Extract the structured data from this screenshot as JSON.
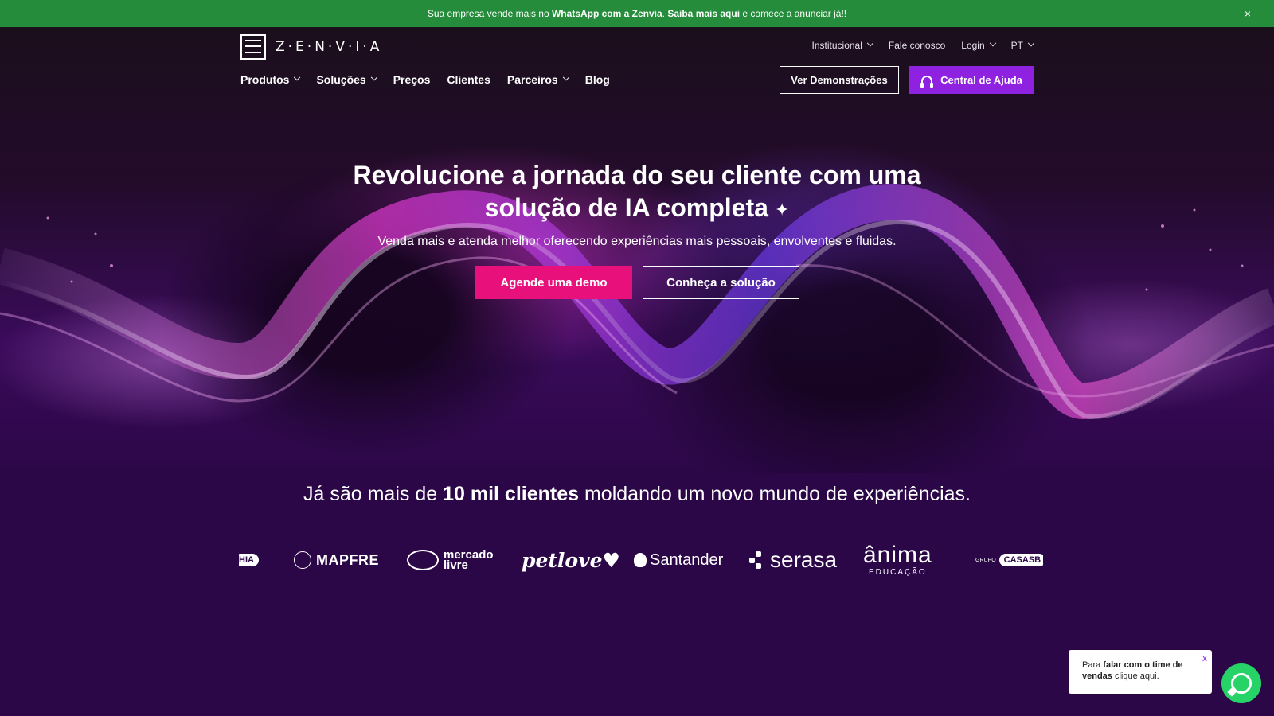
{
  "announcement": {
    "prefix": "Sua empresa vende mais no ",
    "bold": "WhatsApp com a Zenvia",
    "dot": ". ",
    "link": "Saiba mais aqui",
    "suffix": " e comece a anunciar já!!",
    "close": "×"
  },
  "header": {
    "logo_text": "Z·E·N·V·I·A",
    "topnav": [
      {
        "label": "Institucional",
        "dropdown": true
      },
      {
        "label": "Fale conosco",
        "dropdown": false
      },
      {
        "label": "Login",
        "dropdown": true
      },
      {
        "label": "PT",
        "dropdown": true
      }
    ],
    "mainnav": [
      {
        "label": "Produtos",
        "dropdown": true
      },
      {
        "label": "Soluções",
        "dropdown": true
      },
      {
        "label": "Preços",
        "dropdown": false
      },
      {
        "label": "Clientes",
        "dropdown": false
      },
      {
        "label": "Parceiros",
        "dropdown": true
      },
      {
        "label": "Blog",
        "dropdown": false
      }
    ],
    "btn_demos": "Ver Demonstrações",
    "btn_help": "Central de Ajuda"
  },
  "hero": {
    "title_line1": "Revolucione a jornada do seu cliente com uma",
    "title_line2": "solução de IA completa",
    "subtitle": "Venda mais e atenda melhor oferecendo experiências mais pessoais, envolventes e fluidas.",
    "btn_primary": "Agende uma demo",
    "btn_secondary": "Conheça a solução"
  },
  "clients": {
    "title_prefix": "Já são mais de ",
    "title_bold": "10 mil clientes",
    "title_suffix": " moldando um novo mundo de experiências.",
    "logos": {
      "edge_left": "HIA",
      "mapfre": "MAPFRE",
      "mercado_1": "mercado",
      "mercado_2": "livre",
      "petlove": "petlove♥",
      "santander": "Santander",
      "serasa": "serasa",
      "anima_big": "ânima",
      "anima_small": "EDUCAÇÃO",
      "casas_prefix": "GRUPO",
      "casas_pill": "CASASB"
    }
  },
  "chat": {
    "prefix": "Para ",
    "bold": "falar com o time de vendas",
    "suffix": " clique aqui.",
    "close": "x"
  },
  "colors": {
    "announce_bg": "#248c3a",
    "bg": "#2c0748",
    "pink": "#e8107a",
    "purple": "#8e22e0",
    "whatsapp": "#25d366"
  }
}
